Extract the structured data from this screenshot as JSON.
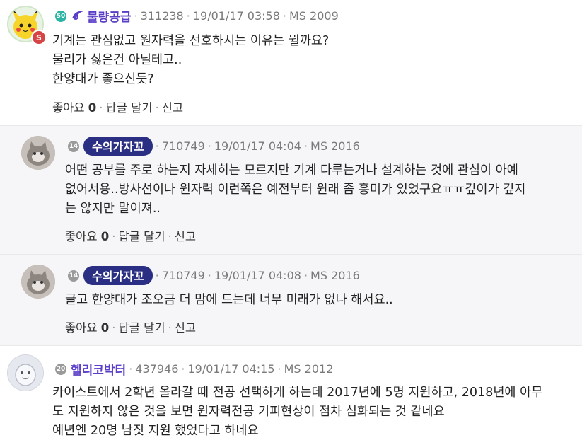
{
  "comments": [
    {
      "level": "50",
      "nickname": "물량공급",
      "user_id": "311238",
      "datetime": "19/01/17 03:58",
      "ms": "MS 2009",
      "body": "기계는 관심없고 원자력을 선호하시는 이유는 뭘까요?\n물리가 싫은건 아닐테고..\n한양대가 좋으신듯?",
      "like_label": "좋아요",
      "like_count": "0",
      "reply_label": "답글 달기",
      "report_label": "신고",
      "avatar_badge": "S"
    },
    {
      "level": "14",
      "nickname": "수의가자꼬",
      "user_id": "710749",
      "datetime": "19/01/17 04:04",
      "ms": "MS 2016",
      "body": "어떤 공부를 주로 하는지 자세히는 모르지만 기계 다루는거나 설계하는 것에 관심이 아예\n없어서용..방사선이나 원자력 이런쪽은 예전부터 원래 좀 흥미가 있었구요ㅠㅠ깊이가 깊지\n는 않지만 말이져..",
      "like_label": "좋아요",
      "like_count": "0",
      "reply_label": "답글 달기",
      "report_label": "신고"
    },
    {
      "level": "14",
      "nickname": "수의가자꼬",
      "user_id": "710749",
      "datetime": "19/01/17 04:08",
      "ms": "MS 2016",
      "body": "글고 한양대가 조오금 더 맘에 드는데 너무 미래가 없나 해서요..",
      "like_label": "좋아요",
      "like_count": "0",
      "reply_label": "답글 달기",
      "report_label": "신고"
    },
    {
      "level": "20",
      "nickname": "헬리코박터",
      "user_id": "437946",
      "datetime": "19/01/17 04:15",
      "ms": "MS 2012",
      "body": "카이스트에서 2학년 올라갈 때 전공 선택하게 하는데 2017년에 5명 지원하고, 2018년에 아무\n도 지원하지 않은 것을 보면 원자력전공 기피현상이 점차 심화되는 것 같네요\n예년엔 20명 남짓 지원 했었다고 하네요"
    }
  ],
  "colors": {
    "nick_purple": "#5b3fc8",
    "nick_badge_bg": "#2b2f84",
    "level_teal": "#2bb3a3",
    "level_gray": "#9a9a9a",
    "reply_bg": "#f6f6f8"
  }
}
